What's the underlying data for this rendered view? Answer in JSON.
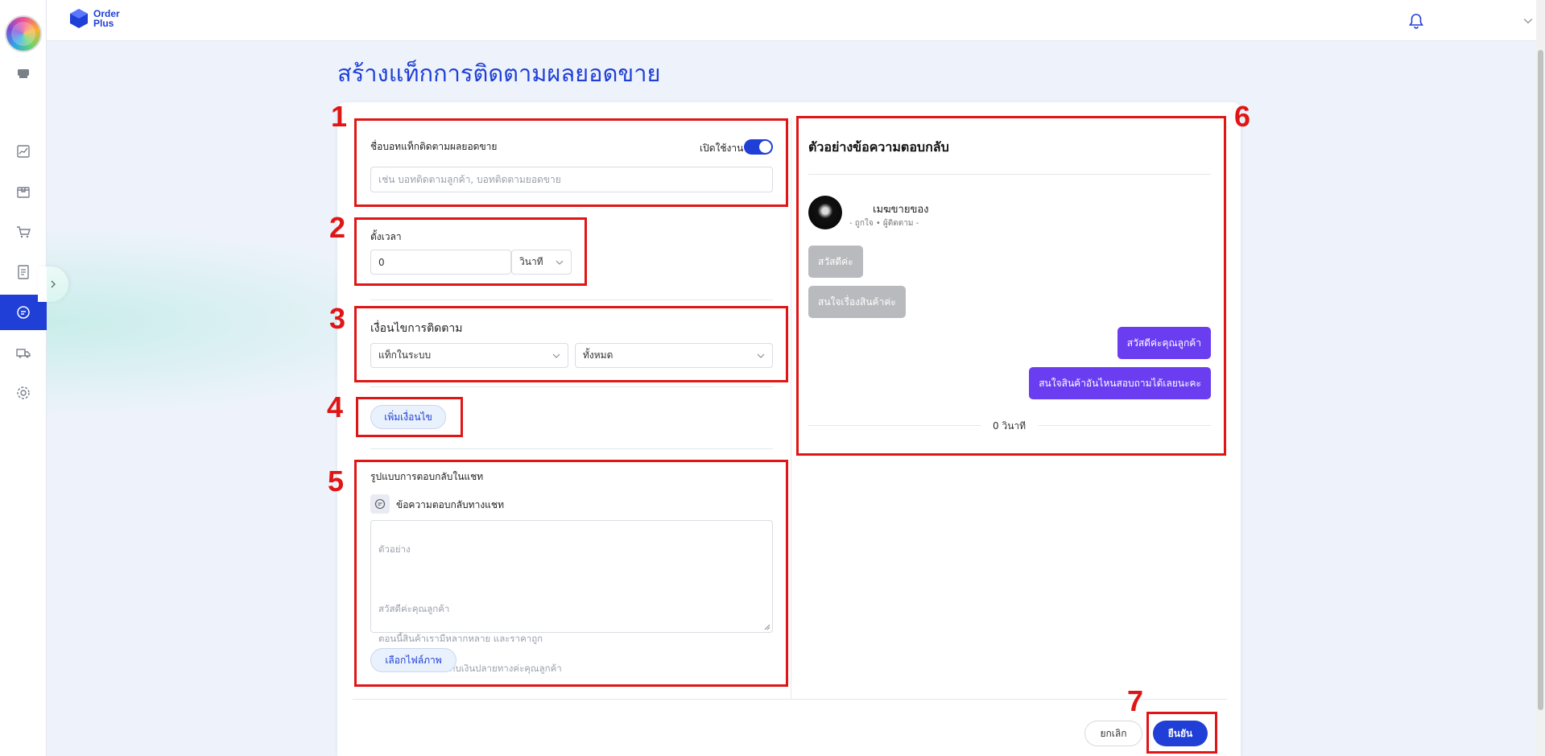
{
  "brand": {
    "line1": "Order",
    "line2": "Plus"
  },
  "page": {
    "title": "สร้างแท็กการติดตามผลยอดขาย"
  },
  "form": {
    "tag_name": {
      "label": "ชื่อบอทแท็กติดตามผลยอดขาย",
      "enable_label": "เปิดใช้งาน",
      "enabled": true,
      "placeholder": "เช่น บอทติดตามลูกค้า, บอทติดตามยอดขาย"
    },
    "timer": {
      "label": "ตั้งเวลา",
      "value": "0",
      "unit": "วินาที"
    },
    "condition": {
      "label": "เงื่อนไขการติดตาม",
      "type": "แท็กในระบบ",
      "scope": "ทั้งหมด"
    },
    "add_condition_label": "เพิ่มเงื่อนไข",
    "reply": {
      "label": "รูปแบบการตอบกลับในแชท",
      "chat_label": "ข้อความตอบกลับทางแชท",
      "placeholder_lines": [
        "ตัวอย่าง",
        "",
        "สวัสดีค่ะคุณลูกค้า",
        "ตอนนี้สินค้าเรามีหลากหลาย และราคาถูก",
        "สั่งตอนนี้ ส่งฟรี มีเก็บเงินปลายทางค่ะคุณลูกค้า"
      ],
      "image_button": "เลือกไฟล์ภาพ"
    }
  },
  "preview": {
    "title": "ตัวอย่างข้อความตอบกลับ",
    "page_name": "เมฆขายของ",
    "page_meta": "- ถูกใจ • ผู้ติดตาม -",
    "incoming": [
      "สวัสดีค่ะ",
      "สนใจเรื่องสินค้าค่ะ"
    ],
    "outgoing": [
      "สวัสดีค่ะคุณลูกค้า",
      "สนใจสินค้าอันไหนสอบถามได้เลยนะคะ"
    ],
    "delay": "0 วินาที"
  },
  "footer": {
    "cancel": "ยกเลิก",
    "confirm": "ยืนยัน"
  },
  "annotations": [
    "1",
    "2",
    "3",
    "4",
    "5",
    "6",
    "7"
  ],
  "colors": {
    "primary": "#1f3fd6",
    "bubble_out": "#6a3ef0",
    "bubble_in": "#b9babd",
    "annotation": "#e01515"
  },
  "icons": {
    "sidebar": [
      "store-icon",
      "chart-icon",
      "box-icon",
      "cart-icon",
      "document-icon",
      "chat-icon",
      "truck-icon",
      "gear-icon"
    ],
    "top": [
      "bell-icon",
      "chevron-down-icon"
    ]
  }
}
